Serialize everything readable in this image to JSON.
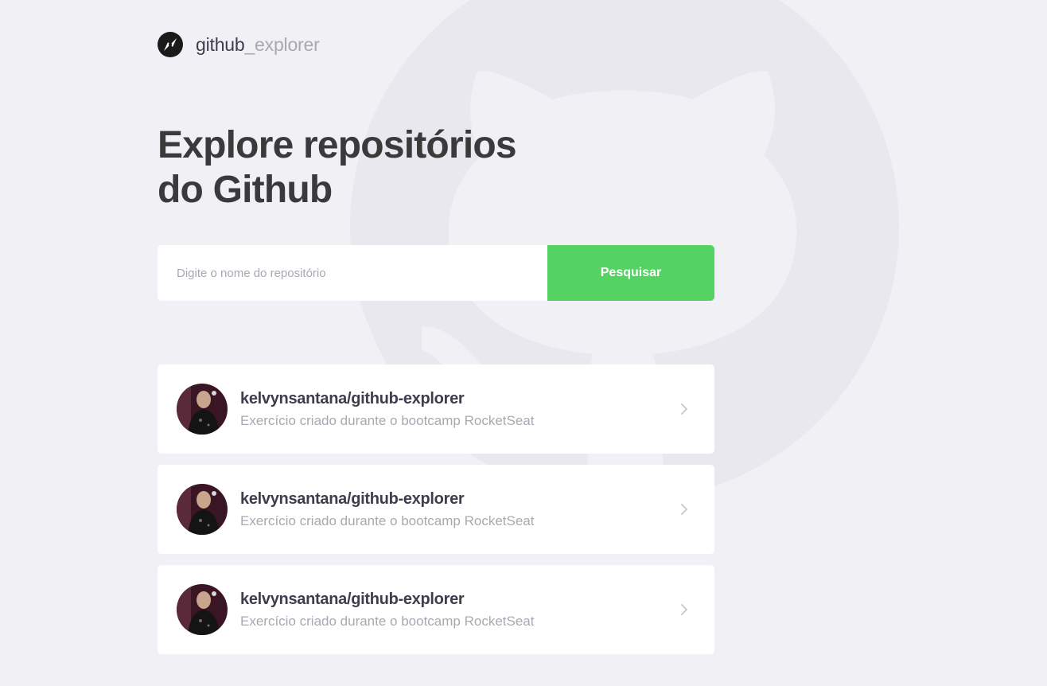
{
  "brand": {
    "name_main": "github",
    "name_accent": "_explorer"
  },
  "headline": {
    "line1": "Explore repositórios",
    "line2": "do Github"
  },
  "search": {
    "placeholder": "Digite o nome do repositório",
    "value": "",
    "button_label": "Pesquisar"
  },
  "repositories": [
    {
      "name": "kelvynsantana/github-explorer",
      "description": "Exercício criado durante o bootcamp RocketSeat"
    },
    {
      "name": "kelvynsantana/github-explorer",
      "description": "Exercício criado durante o bootcamp RocketSeat"
    },
    {
      "name": "kelvynsantana/github-explorer",
      "description": "Exercício criado durante o bootcamp RocketSeat"
    }
  ],
  "colors": {
    "background": "#F0F0F5",
    "title": "#3A3A3A",
    "text_primary": "#3D3D4D",
    "text_muted": "#A8A8B3",
    "accent_green": "#54D363",
    "card": "#FFFFFF"
  },
  "icons": {
    "logo": "compass-icon",
    "background": "github-octocat-icon",
    "card_action": "chevron-right-icon",
    "avatar": "user-avatar"
  }
}
